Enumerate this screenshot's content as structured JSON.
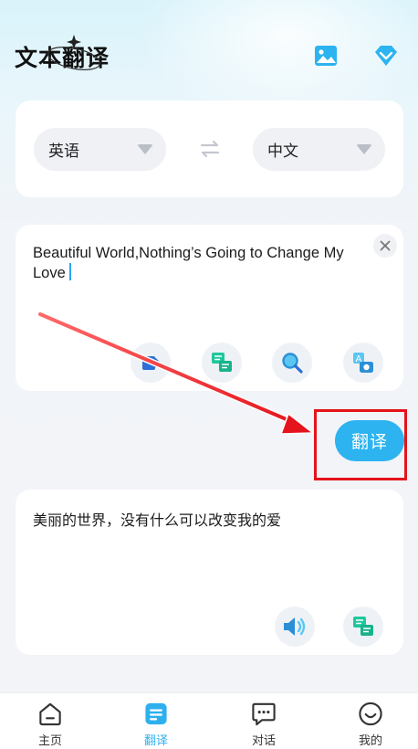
{
  "header": {
    "title": "文本翻译",
    "icons": [
      "image-icon",
      "vip-diamond-icon"
    ]
  },
  "languages": {
    "source": "英语",
    "target": "中文",
    "swap_icon": "swap-arrows-icon"
  },
  "input": {
    "text": "Beautiful World,Nothing’s Going to Change My Love",
    "clear_icon": "close-icon",
    "tools": [
      "import-icon",
      "chat-bubbles-icon",
      "search-magnifier-icon",
      "ocr-camera-icon"
    ]
  },
  "action": {
    "translate_label": "翻译"
  },
  "result": {
    "text": "美丽的世界，没有什么可以改变我的爱",
    "tools": [
      "speaker-icon",
      "chat-bubbles-icon"
    ]
  },
  "tabbar": {
    "items": [
      {
        "label": "主页",
        "icon": "home-icon",
        "active": false
      },
      {
        "label": "翻译",
        "icon": "translate-doc-icon",
        "active": true
      },
      {
        "label": "对话",
        "icon": "dialog-icon",
        "active": false
      },
      {
        "label": "我的",
        "icon": "smile-profile-icon",
        "active": false
      }
    ]
  },
  "colors": {
    "accent": "#2cb3f0",
    "annotation_red": "#e5131b",
    "pill_bg": "#eff1f5"
  }
}
